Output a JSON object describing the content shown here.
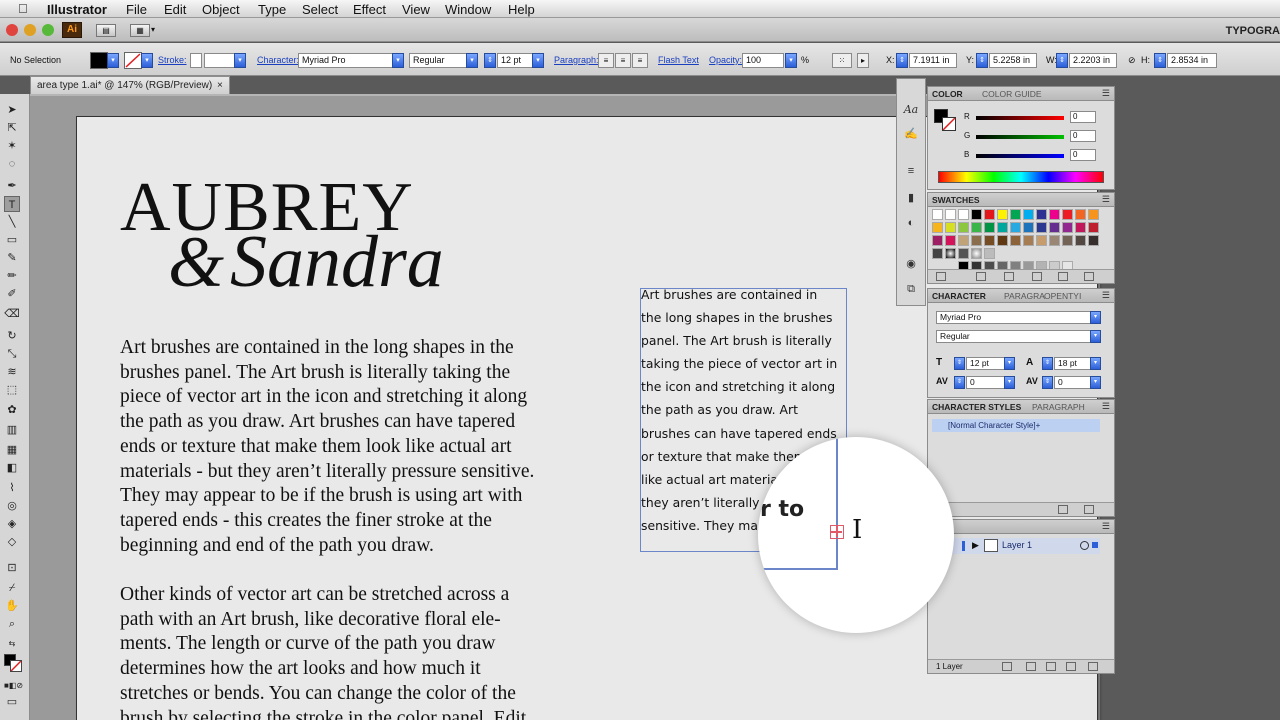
{
  "menubar": {
    "app": "Illustrator",
    "items": [
      "File",
      "Edit",
      "Object",
      "Type",
      "Select",
      "Effect",
      "View",
      "Window",
      "Help"
    ]
  },
  "appframe": {
    "logo": "Ai",
    "workspace": "TYPOGRA"
  },
  "controlbar": {
    "selection": "No Selection",
    "stroke_label": "Stroke:",
    "character_label": "Character:",
    "font": "Myriad Pro",
    "style": "Regular",
    "size": "12 pt",
    "paragraph_label": "Paragraph:",
    "flash_text": "Flash Text",
    "opacity_label": "Opacity:",
    "opacity": "100",
    "percent": "%",
    "x_label": "X:",
    "x": "7.1911 in",
    "y_label": "Y:",
    "y": "5.2258 in",
    "w_label": "W:",
    "w": "2.2203 in",
    "h_label": "H:",
    "h": "2.8534 in"
  },
  "document": {
    "tab_title": "area type 1.ai* @ 147% (RGB/Preview)",
    "close": "×"
  },
  "artboard": {
    "title_line1": "AUBREY",
    "title_amp": "&",
    "title_line2": "Sandra",
    "para1_lines": [
      "Art brushes are contained in the long shapes in the",
      "brushes panel.  The Art brush is literally taking the",
      "piece of vector art in the icon and stretching it along",
      "the path as you draw. Art brushes can have tapered",
      "ends or texture that make them look like actual art",
      "materials - but they aren’t literally pressure sensitive.",
      "They may appear to be if the brush is using art with",
      "tapered ends - this creates the finer stroke at the",
      "beginning and end of the path you draw."
    ],
    "para2_lines": [
      "Other kinds of vector art can be stretched across a",
      "path with an Art brush, like decorative floral ele-",
      "ments. The length or curve of the path you draw",
      "determines how the art looks and how much it",
      "stretches or bends. You can change the color of the",
      "brush by selecting the stroke in the color panel. Edit"
    ],
    "areatype_lines": [
      "Art brushes are contained in",
      "the long shapes in the brushes",
      "panel.  The Art brush is literally",
      "taking the piece of vector art in",
      "the icon and stretching it along",
      "the path as you draw. Art",
      "brushes can have tapered ends",
      "or texture that make them",
      "like actual art materia",
      "they aren’t literally",
      "sensitive. They ma"
    ],
    "magnifier_text": "r to"
  },
  "panels": {
    "color": {
      "tab1": "COLOR",
      "tab2": "COLOR GUIDE",
      "r_label": "R",
      "r": "0",
      "g_label": "G",
      "g": "0",
      "b_label": "B",
      "b": "0"
    },
    "swatches": {
      "tab": "SWATCHES"
    },
    "character": {
      "tab1": "CHARACTER",
      "tab2": "PARAGRA",
      "tab3": "OPENTYI",
      "font": "Myriad Pro",
      "style": "Regular",
      "size": "12 pt",
      "leading": "18 pt",
      "kerning": "0",
      "tracking": "0"
    },
    "charstyles": {
      "tab1": "CHARACTER STYLES",
      "tab2": "PARAGRAPH",
      "item": "[Normal Character Style]+"
    },
    "layers": {
      "tab": "RS",
      "layer_name": "Layer 1",
      "count": "1 Layer"
    }
  },
  "colors": {
    "accent": "#2c5fd8",
    "selection_box": "#6b86c9",
    "ai_logo_bg": "#4a2a0c",
    "ai_logo_fg": "#ff9a1a"
  }
}
